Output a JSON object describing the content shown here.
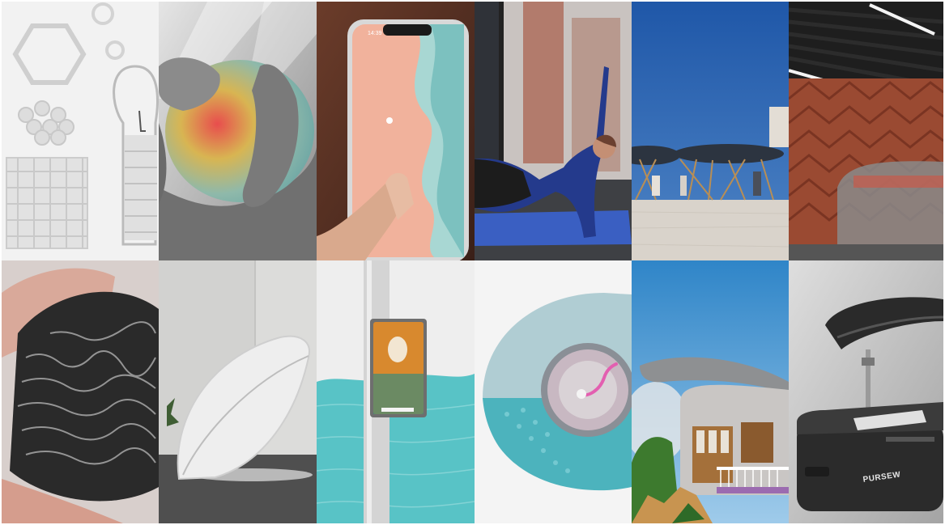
{
  "tiles": [
    {
      "name": "white-3d-printed-lattice-objects",
      "caption": ""
    },
    {
      "name": "hand-squeezing-glowing-ball",
      "caption": ""
    },
    {
      "name": "hand-holding-smartphone-app",
      "caption": "",
      "clock": "14:39"
    },
    {
      "name": "woman-doing-yoga-on-mat",
      "caption": ""
    },
    {
      "name": "canopy-structures-in-desert",
      "caption": ""
    },
    {
      "name": "brick-wall-subway-station",
      "caption": ""
    },
    {
      "name": "hands-holding-dark-textured-material",
      "caption": ""
    },
    {
      "name": "white-shell-shaped-pod-chair",
      "caption": ""
    },
    {
      "name": "pole-mounted-water-sensor",
      "caption": ""
    },
    {
      "name": "spiral-glass-device",
      "caption": ""
    },
    {
      "name": "curved-roof-house",
      "caption": ""
    },
    {
      "name": "sewing-machine-device",
      "caption": "",
      "brand": "PURSEW"
    }
  ],
  "colors": {
    "sky_blue": "#2f68b5",
    "phone_screen": "#f1b29c",
    "teal_water": "#58c3c6",
    "brick": "#9a4a32"
  }
}
